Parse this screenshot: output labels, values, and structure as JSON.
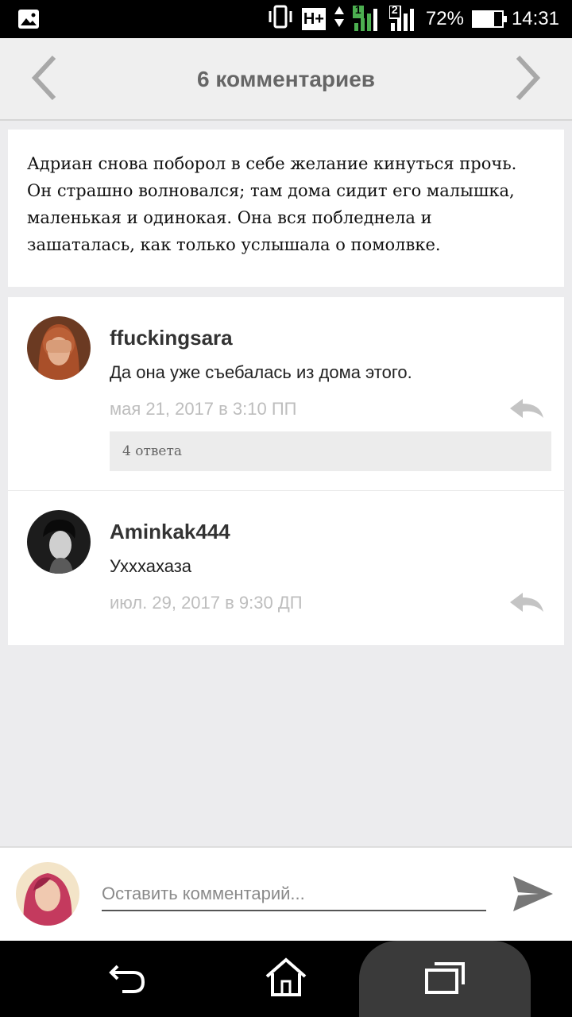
{
  "status_bar": {
    "network_label": "H+",
    "sim1_label": "1",
    "sim2_label": "2",
    "battery_percent": "72%",
    "battery_level": 0.72,
    "time": "14:31"
  },
  "header": {
    "title": "6 комментариев",
    "prev_icon": "chevron-left-icon",
    "next_icon": "chevron-right-icon"
  },
  "quote": {
    "text": "Адриан снова поборол в себе желание кинуться прочь. Он страшно волновался; там дома сидит его малышка, маленькая и одинокая. Она вся побледнела и зашаталась, как только услышала о помолвке."
  },
  "comments": [
    {
      "author": "ffuckingsara",
      "text": "Да она уже съебалась из дома этого.",
      "date": "мая 21, 2017 в 3:10 ПП",
      "replies_label": "4 ответа"
    },
    {
      "author": "Aminkak444",
      "text": "Ухххахаза",
      "date": "июл. 29, 2017 в 9:30 ДП"
    }
  ],
  "compose": {
    "placeholder": "Оставить комментарий..."
  },
  "colors": {
    "header_bg": "#efefef",
    "page_bg": "#ececee",
    "date_text": "#bdbdbd"
  }
}
